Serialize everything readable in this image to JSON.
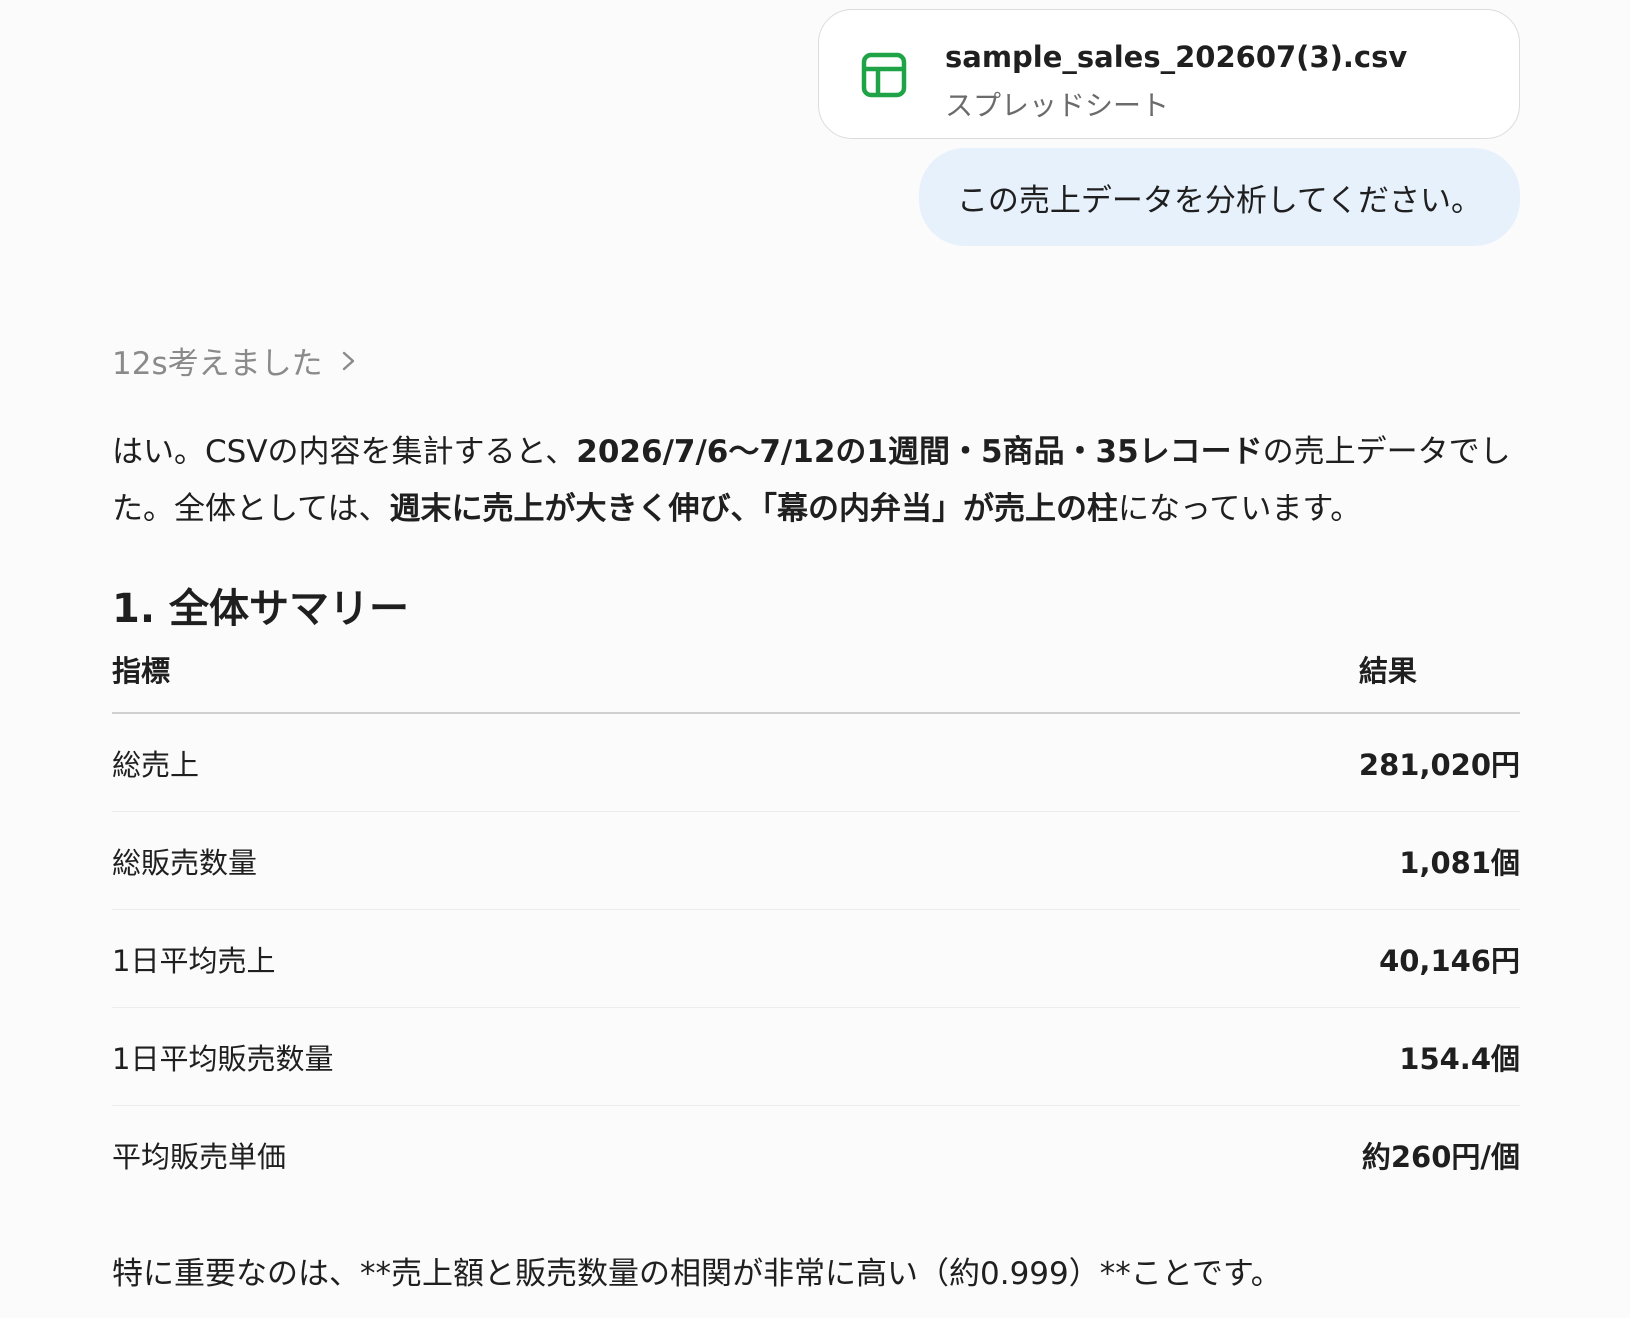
{
  "attachment": {
    "file_name": "sample_sales_202607(3).csv",
    "file_type": "スプレッドシート",
    "icon": "spreadsheet-icon",
    "icon_color": "#1ea446"
  },
  "user_message": "この売上データを分析してください。",
  "thinking": {
    "label": "12s考えました",
    "icon": "chevron-right-icon"
  },
  "intro": {
    "t1": "はい。CSVの内容を集計すると、",
    "b1": "2026/7/6〜7/12の1週間・5商品・35レコード",
    "t2": "の売上データでした。全体としては、",
    "b2": "週末に売上が大きく伸び、「幕の内弁当」が売上の柱",
    "t3": "になっています。"
  },
  "section_title": "1. 全体サマリー",
  "table": {
    "header": {
      "metric": "指標",
      "result": "結果"
    },
    "rows": [
      {
        "metric": "総売上",
        "value": "281,020円"
      },
      {
        "metric": "総販売数量",
        "value": "1,081個"
      },
      {
        "metric": "1日平均売上",
        "value": "40,146円"
      },
      {
        "metric": "1日平均販売数量",
        "value": "154.4個"
      },
      {
        "metric": "平均販売単価",
        "value": "約260円/個"
      }
    ]
  },
  "note": "特に重要なのは、**売上額と販売数量の相関が非常に高い（約0.999）**ことです。",
  "colors": {
    "user_bubble_bg": "#e7f1fc",
    "page_bg": "#fbfbfb"
  }
}
